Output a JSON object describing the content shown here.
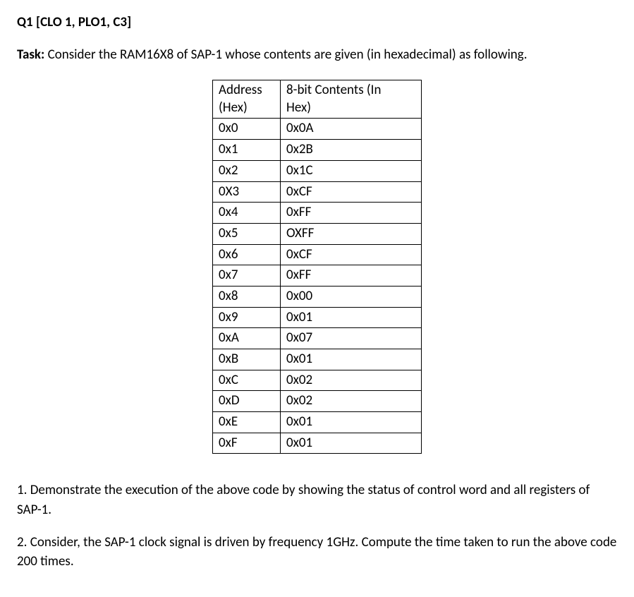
{
  "question_header": "Q1 [CLO 1, PLO1, C3]",
  "task_label": "Task:",
  "task_text": " Consider the RAM16X8 of SAP-1 whose contents are given (in hexadecimal) as following.",
  "table": {
    "header_addr_line1": "Address",
    "header_addr_line2": "(Hex)",
    "header_cont_line1": "8-bit Contents (In",
    "header_cont_line2": "Hex)",
    "rows": [
      {
        "addr": "0x0",
        "cont": "0x0A"
      },
      {
        "addr": "0x1",
        "cont": "0x2B"
      },
      {
        "addr": "0x2",
        "cont": "0x1C"
      },
      {
        "addr": "0X3",
        "cont": "0xCF"
      },
      {
        "addr": "0x4",
        "cont": "0xFF"
      },
      {
        "addr": "0x5",
        "cont": "OXFF"
      },
      {
        "addr": "0x6",
        "cont": "0xCF"
      },
      {
        "addr": "0x7",
        "cont": "0xFF"
      },
      {
        "addr": "0x8",
        "cont": "0x00"
      },
      {
        "addr": "0x9",
        "cont": "0x01"
      },
      {
        "addr": "0xA",
        "cont": "0x07"
      },
      {
        "addr": "0xB",
        "cont": "0x01"
      },
      {
        "addr": "0xC",
        "cont": "0x02"
      },
      {
        "addr": "0xD",
        "cont": "0x02"
      },
      {
        "addr": "0xE",
        "cont": "0x01"
      },
      {
        "addr": "0xF",
        "cont": "0x01"
      }
    ]
  },
  "subq1": "1. Demonstrate the execution of the above code by showing the status of control word and all registers of SAP-1.",
  "subq2": "2. Consider, the SAP-1 clock signal is driven by frequency 1GHz. Compute the time taken to run the above code 200 times."
}
